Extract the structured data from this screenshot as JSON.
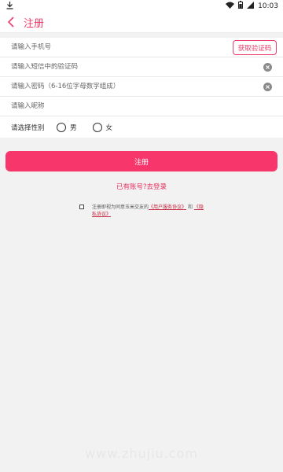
{
  "status_bar": {
    "time": "10:03",
    "icons": [
      "download-icon",
      "wifi-icon",
      "battery-icon",
      "signal-icon"
    ]
  },
  "header": {
    "title": "注册",
    "back_icon": "chevron-left-icon"
  },
  "form": {
    "phone_placeholder": "请输入手机号",
    "get_code_label": "获取验证码",
    "sms_code_placeholder": "请输入短信中的验证码",
    "password_placeholder": "请输入密码（6-16位字母数字组成）",
    "nickname_placeholder": "请输入昵称",
    "gender_label": "请选择性别",
    "gender_options": [
      "男",
      "女"
    ]
  },
  "register_label": "注册",
  "login_link": "已有账号?去登录",
  "agreement": {
    "prefix": "注册即视为同意玉米交友的",
    "user_agreement": "《用户服务协议》",
    "and": "和",
    "privacy_policy": "《隐私协议》"
  },
  "watermark": "www.zhujiu.com",
  "colors": {
    "accent": "#f7376b",
    "title": "#ee3c6b",
    "link": "#c4273f"
  }
}
